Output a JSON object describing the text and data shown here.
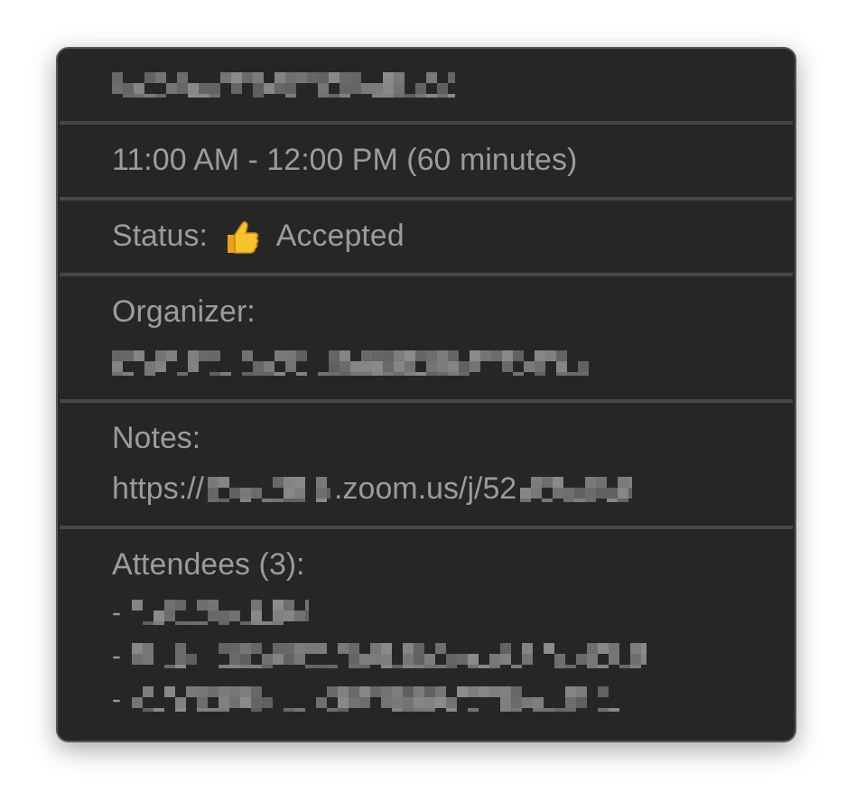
{
  "event": {
    "title": [
      {
        "kind": "redacted"
      }
    ],
    "time": "11:00 AM - 12:00 PM (60 minutes)",
    "status": {
      "label": "Status:",
      "value": "Accepted"
    },
    "organizer": {
      "label": "Organizer:",
      "value": [
        {
          "kind": "redacted"
        }
      ]
    },
    "notes": {
      "label": "Notes:",
      "value": [
        {
          "kind": "text",
          "text": "https://"
        },
        {
          "kind": "redacted"
        },
        {
          "kind": "text",
          "text": ".zoom.us/j/52"
        },
        {
          "kind": "redacted"
        }
      ]
    },
    "attendees": {
      "label": "Attendees (3):",
      "items": [
        {
          "bullet": "-",
          "value": [
            {
              "kind": "redacted"
            }
          ]
        },
        {
          "bullet": "-",
          "value": [
            {
              "kind": "redacted"
            }
          ]
        },
        {
          "bullet": "-",
          "value": [
            {
              "kind": "redacted"
            }
          ]
        }
      ]
    }
  }
}
